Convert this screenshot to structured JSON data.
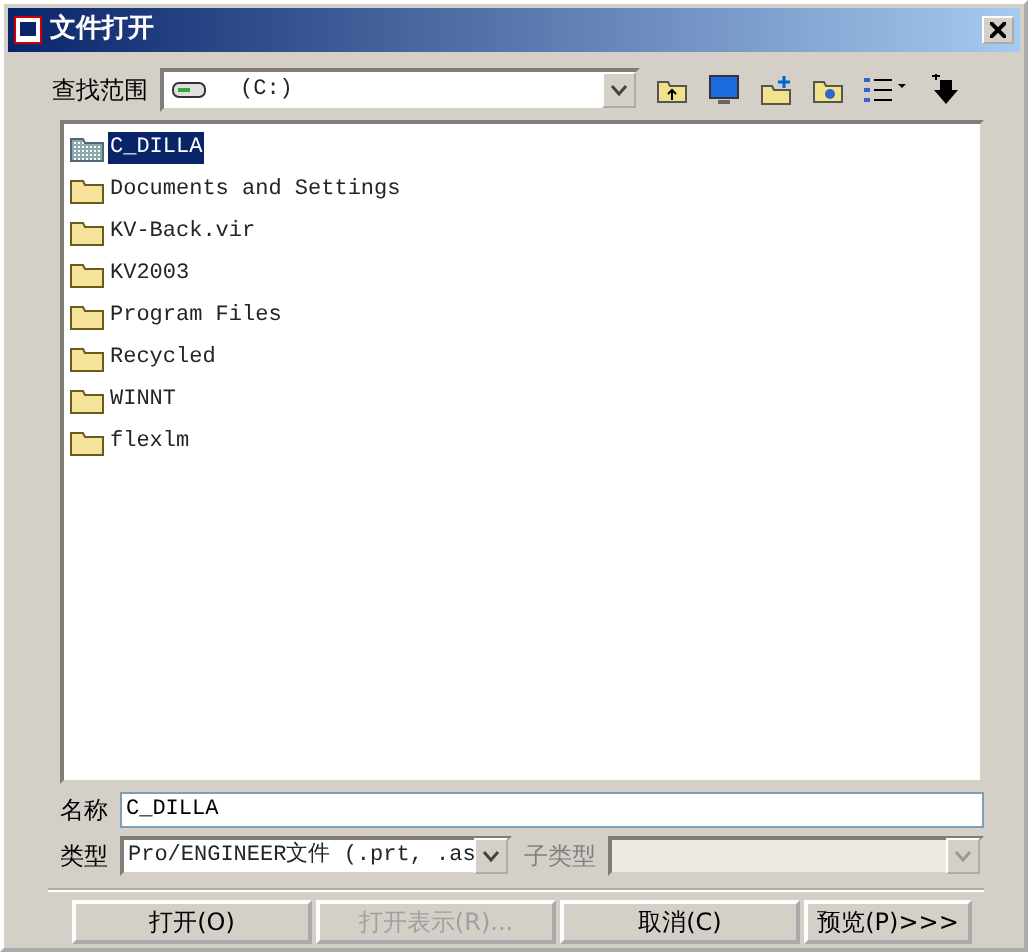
{
  "window": {
    "title": "文件打开"
  },
  "look_in": {
    "label": "查找范围",
    "value": "(C:)"
  },
  "files": [
    {
      "name": "C_DILLA",
      "hidden": true,
      "selected": true
    },
    {
      "name": "Documents and Settings",
      "hidden": false,
      "selected": false
    },
    {
      "name": "KV-Back.vir",
      "hidden": false,
      "selected": false
    },
    {
      "name": "KV2003",
      "hidden": false,
      "selected": false
    },
    {
      "name": "Program Files",
      "hidden": false,
      "selected": false
    },
    {
      "name": "Recycled",
      "hidden": false,
      "selected": false
    },
    {
      "name": "WINNT",
      "hidden": false,
      "selected": false
    },
    {
      "name": "flexlm",
      "hidden": false,
      "selected": false
    }
  ],
  "name_field": {
    "label": "名称",
    "value": "C_DILLA"
  },
  "type_field": {
    "label": "类型",
    "value": "Pro/ENGINEER文件 (.prt, .as"
  },
  "subtype_field": {
    "label": "子类型",
    "disabled": true
  },
  "buttons": [
    {
      "label": "打开(O)",
      "disabled": false
    },
    {
      "label": "打开表示(R)...",
      "disabled": true
    },
    {
      "label": "取消(C)",
      "disabled": false
    },
    {
      "label": "预览(P)>>>",
      "disabled": false
    }
  ]
}
